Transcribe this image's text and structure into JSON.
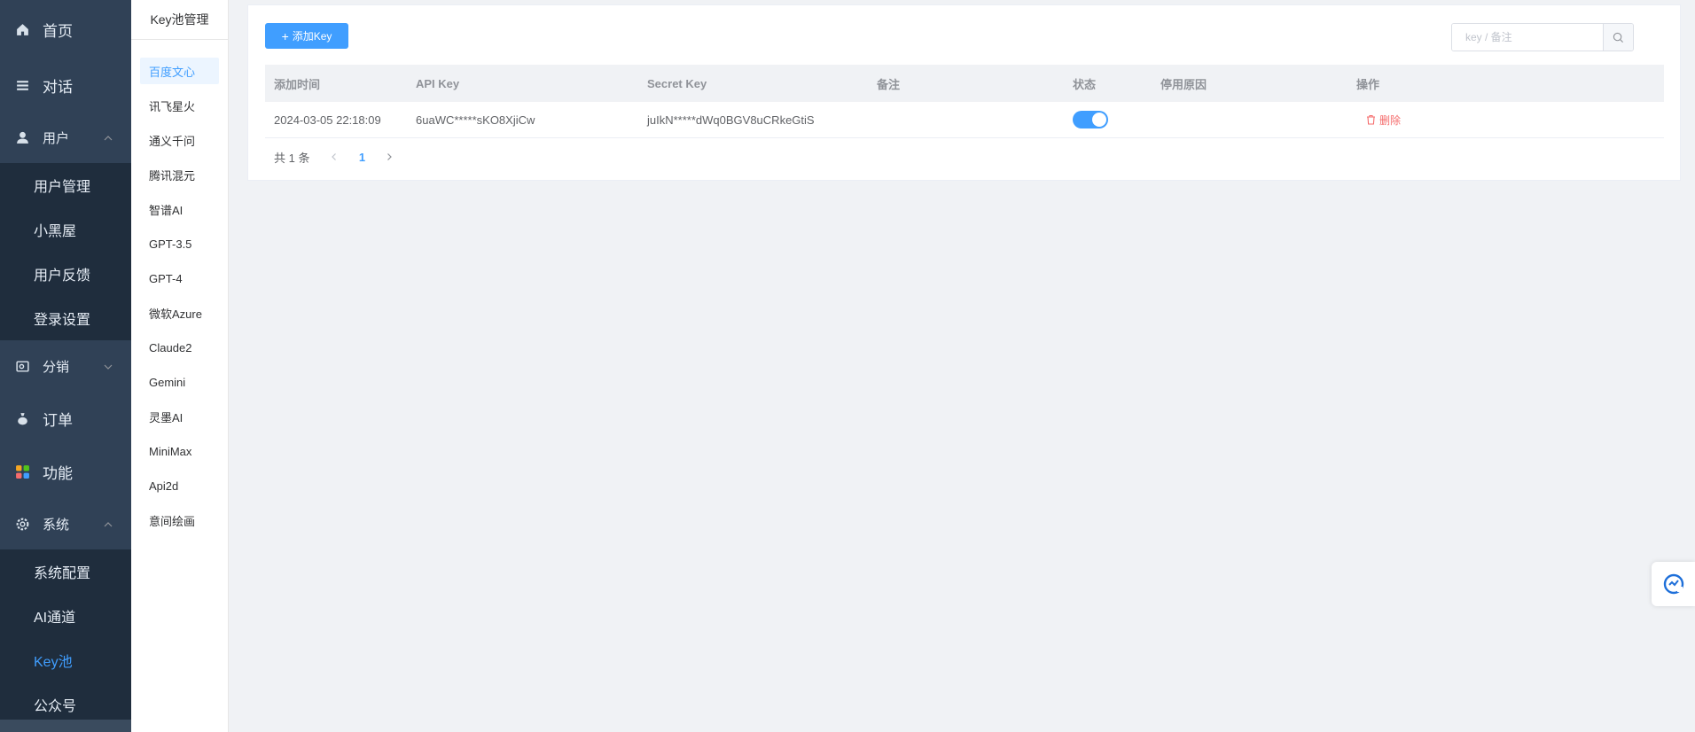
{
  "sidebar": {
    "items": [
      {
        "label": "首页",
        "icon": "home-icon"
      },
      {
        "label": "对话",
        "icon": "list-icon"
      },
      {
        "label": "用户",
        "icon": "user-icon",
        "expanded": true
      },
      {
        "label": "分销",
        "icon": "distribution-icon",
        "expanded": false
      },
      {
        "label": "订单",
        "icon": "money-bag-icon"
      },
      {
        "label": "功能",
        "icon": "apps-icon"
      },
      {
        "label": "系统",
        "icon": "gear-icon",
        "expanded": true
      }
    ],
    "user_sub": [
      "用户管理",
      "小黑屋",
      "用户反馈",
      "登录设置"
    ],
    "system_sub": [
      "系统配置",
      "AI通道",
      "Key池",
      "公众号"
    ],
    "active_sub": "Key池"
  },
  "providers": {
    "title": "Key池管理",
    "items": [
      "百度文心",
      "讯飞星火",
      "通义千问",
      "腾讯混元",
      "智谱AI",
      "GPT-3.5",
      "GPT-4",
      "微软Azure",
      "Claude2",
      "Gemini",
      "灵墨AI",
      "MiniMax",
      "Api2d",
      "意间绘画"
    ],
    "active": "百度文心"
  },
  "toolbar": {
    "add_label": "添加Key",
    "search_placeholder": "key / 备注"
  },
  "table": {
    "headers": [
      "添加时间",
      "API Key",
      "Secret Key",
      "备注",
      "状态",
      "停用原因",
      "操作"
    ],
    "rows": [
      {
        "time": "2024-03-05 22:18:09",
        "api_key": "6uaWC*****sKO8XjiCw",
        "secret_key": "juIkN*****dWq0BGV8uCRkeGtiS",
        "note": "",
        "status_on": true,
        "reason": "",
        "action": "删除"
      }
    ]
  },
  "pagination": {
    "total": "共 1 条",
    "current": "1"
  },
  "colors": {
    "sidebar_bg": "#304156",
    "submenu_bg": "#1f2d3d",
    "primary": "#409eff",
    "danger": "#f56c6c"
  }
}
